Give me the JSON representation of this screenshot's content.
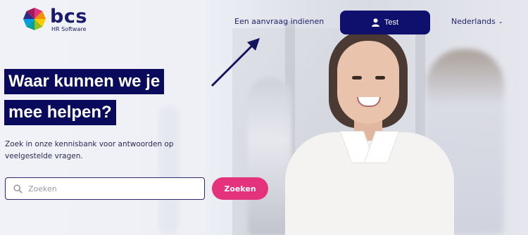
{
  "brand": {
    "name": "bcs",
    "tagline": "HR Software",
    "colors": {
      "navy": "#0f0f6e",
      "pink": "#e5327d"
    }
  },
  "header": {
    "request_link": "Een aanvraag indienen",
    "user_button": {
      "icon": "user-icon",
      "label": "Test"
    },
    "language": {
      "label": "Nederlands",
      "icon": "chevron-down-icon"
    }
  },
  "hero": {
    "headline_line1": "Waar kunnen we je",
    "headline_line2": "mee helpen?",
    "description": "Zoek in onze kennisbank voor antwoorden op veelgestelde vragen."
  },
  "search": {
    "placeholder": "Zoeken",
    "value": "",
    "icon": "search-icon",
    "button_label": "Zoeken"
  }
}
